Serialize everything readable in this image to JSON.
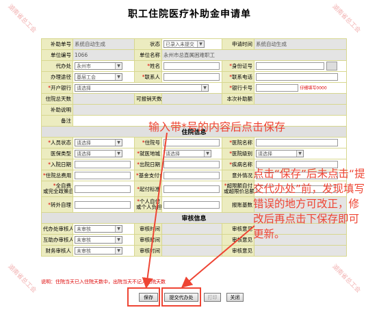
{
  "title": "职工住院医疗补助金申请单",
  "rows": {
    "r1": {
      "l1": "补助单号",
      "v1": "系统自动生成",
      "l2": "状态",
      "v2": "已录入未提交",
      "l3": "申请时间",
      "v3": "系统自动生成"
    },
    "r2": {
      "l1": "单位编号",
      "v1": "1066",
      "l2": "单位名称",
      "v2": "永州市总直属困难职工"
    },
    "r3": {
      "l1": "代办处",
      "v1": "永州市",
      "l2": "姓名",
      "l3": "身份证号"
    },
    "r4": {
      "l1": "办理途径",
      "v1": "基层工会",
      "l2": "联系人",
      "l3": "联系电话"
    },
    "r5": {
      "l1": "开户银行",
      "v1": "请选择",
      "l3": "银行卡号",
      "hint": "仔细填写0000"
    },
    "r6": {
      "l1": "住院总天数",
      "l2": "可报销天数",
      "l3": "本次补助额"
    },
    "r7": {
      "l1": "补助说明"
    },
    "r8": {
      "l1": "备注"
    }
  },
  "sections": {
    "hospital": "住院信息",
    "audit": "审核信息"
  },
  "h": {
    "r1": {
      "l1": "人员状态",
      "v1": "请选择",
      "l2": "住院号",
      "l3": "医院名称"
    },
    "r2": {
      "l1": "医保类型",
      "v1": "请选择",
      "l2": "就医地城",
      "v2": "请选择",
      "l3": "医院级别",
      "v3": "请选择"
    },
    "r3": {
      "l1": "入院日期",
      "l2": "出院日期",
      "l3": "疾病名称"
    },
    "r4": {
      "l1": "住院总费用",
      "l2": "基金支付合计",
      "l3": "意外情况"
    },
    "r5": {
      "l1a": "全自费",
      "l1b": "或完全政策自付",
      "l2": "起付标准",
      "l3a": "超限额自付",
      "l3b": "或超限价总额"
    },
    "r6": {
      "l1": "转外自理",
      "l2a": "个人自付",
      "l2b": "或个人负担",
      "l3": "报账基数"
    }
  },
  "a": {
    "r1": {
      "l1": "代办处审核人",
      "v1": "未审核",
      "l2": "审核时间",
      "l3": "审核意见"
    },
    "r2": {
      "l1": "互助办审核人",
      "v1": "未审核",
      "l2": "审核时间",
      "l3": "审核意见"
    },
    "r3": {
      "l1": "财务审核人",
      "v1": "未审核",
      "l2": "审核时间",
      "l3": "审核意见"
    }
  },
  "note": "说明：住院当天已入住院天数中，出院当天不记入住院天数",
  "buttons": {
    "save": "保存",
    "submit": "提交代办处",
    "print": "打印",
    "close": "关闭"
  },
  "annotations": {
    "a1": "输入带*号的内容后点击保存",
    "a2": "点击“保存”后未点击“提交代办处”前，发现填写错误的地方可改正，修改后再点击下保存即可更新。"
  },
  "watermark": "湖南省总工会",
  "colors": {
    "annotation": "#e43",
    "required": "#d00"
  }
}
